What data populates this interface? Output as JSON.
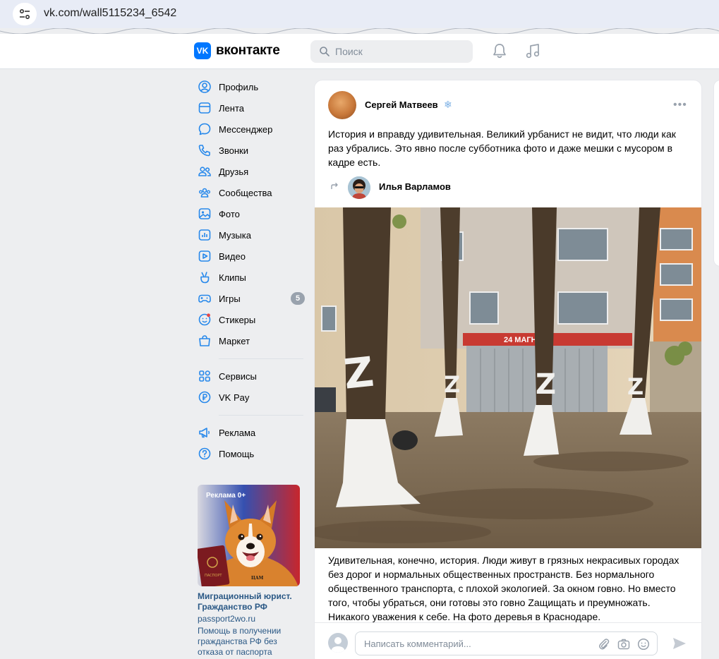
{
  "browser": {
    "url": "vk.com/wall5115234_6542"
  },
  "header": {
    "logo_mark": "VK",
    "logo_text": "вконтакте",
    "search_placeholder": "Поиск"
  },
  "sidebar": {
    "items": [
      {
        "label": "Профиль",
        "icon": "profile-icon"
      },
      {
        "label": "Лента",
        "icon": "feed-icon"
      },
      {
        "label": "Мессенджер",
        "icon": "messenger-icon"
      },
      {
        "label": "Звонки",
        "icon": "calls-icon"
      },
      {
        "label": "Друзья",
        "icon": "friends-icon"
      },
      {
        "label": "Сообщества",
        "icon": "communities-icon"
      },
      {
        "label": "Фото",
        "icon": "photo-icon"
      },
      {
        "label": "Музыка",
        "icon": "music-icon"
      },
      {
        "label": "Видео",
        "icon": "video-icon"
      },
      {
        "label": "Клипы",
        "icon": "clips-icon"
      },
      {
        "label": "Игры",
        "icon": "games-icon",
        "badge": "5"
      },
      {
        "label": "Стикеры",
        "icon": "stickers-icon"
      },
      {
        "label": "Маркет",
        "icon": "market-icon"
      }
    ],
    "items2": [
      {
        "label": "Сервисы",
        "icon": "services-icon"
      },
      {
        "label": "VK Pay",
        "icon": "vkpay-icon"
      }
    ],
    "items3": [
      {
        "label": "Реклама",
        "icon": "ads-icon"
      },
      {
        "label": "Помощь",
        "icon": "help-icon"
      }
    ]
  },
  "ad": {
    "tag": "Реклама 0+",
    "title": "Миграционный юрист. Гражданство РФ",
    "domain": "passport2wo.ru",
    "description": "Помощь в получении гражданства РФ без отказа от паспорта"
  },
  "post": {
    "author": "Сергей Матвеев",
    "author_emoji": "❄",
    "more": "•••",
    "text": "История и вправду удивительная. Великий урбанист не видит, что люди как раз убрались. Это явно после субботника фото и даже мешки с мусором в кадре есть.",
    "repost_author": "Илья Варламов",
    "repost_text": "Удивительная, конечно, история. Люди живут в грязных некрасивых городах без дорог и нормальных общественных пространств. Без нормального общественного транспорта, с плохой экологией. За окном говно. Но вместо того, чтобы убраться, они готовы это говно Zащищать и преумножать. Никакого уважения к себе. На фото деревья в Краснодаре.",
    "photo_sign": "24  МАГНИТ"
  },
  "comment": {
    "placeholder": "Написать комментарий..."
  }
}
